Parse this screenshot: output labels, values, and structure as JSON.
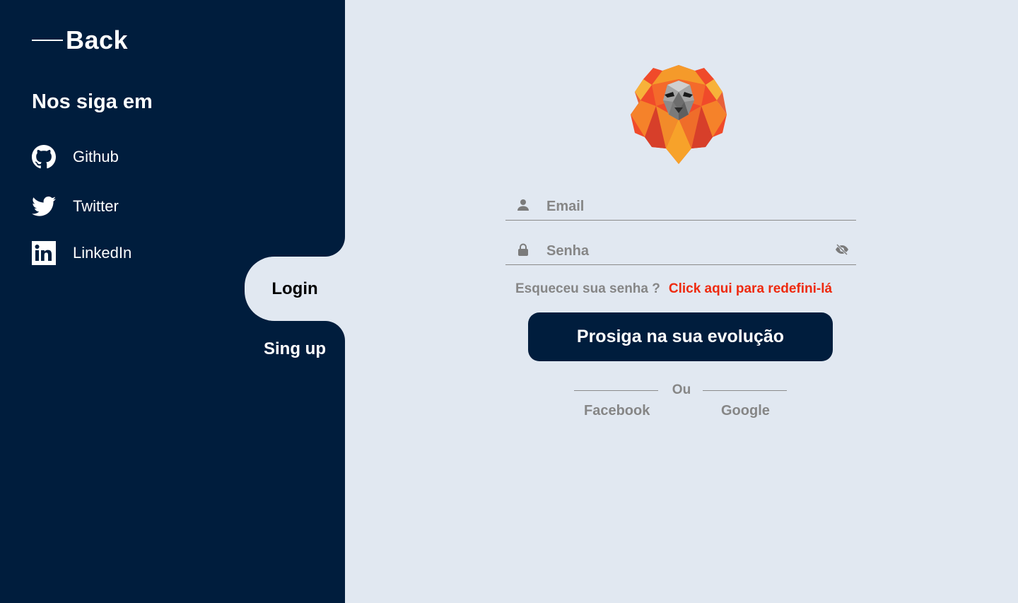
{
  "sidebar": {
    "back_label": "Back",
    "follow_title": "Nos siga em",
    "socials": [
      {
        "label": "Github",
        "icon": "github-icon"
      },
      {
        "label": "Twitter",
        "icon": "twitter-icon"
      },
      {
        "label": "LinkedIn",
        "icon": "linkedin-icon"
      }
    ]
  },
  "tabs": {
    "login": "Login",
    "signup": "Sing up"
  },
  "form": {
    "email_placeholder": "Email",
    "password_placeholder": "Senha",
    "forgot_text": "Esqueceu sua senha ?",
    "forgot_link": "Click aqui para redefini-lá",
    "submit_label": "Prosiga na sua evolução",
    "divider_text": "Ou",
    "oauth": {
      "facebook": "Facebook",
      "google": "Google"
    }
  },
  "colors": {
    "sidebar_bg": "#001d3d",
    "main_bg": "#e1e8f1",
    "accent_link": "#ee2a0f",
    "muted_text": "#868686"
  }
}
